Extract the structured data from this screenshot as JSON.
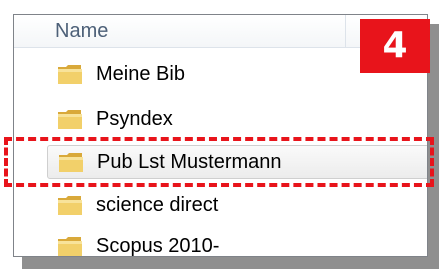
{
  "column_header": {
    "label": "Name"
  },
  "step_badge": {
    "number": "4",
    "color": "#e8141b"
  },
  "folders": [
    {
      "label": "Meine Bib",
      "icon": "folder-icon"
    },
    {
      "label": "Psyndex",
      "icon": "folder-icon"
    },
    {
      "label": "Pub Lst Mustermann",
      "icon": "folder-icon",
      "highlighted": true
    },
    {
      "label": "science direct",
      "icon": "folder-icon"
    },
    {
      "label": "Scopus 2010-",
      "icon": "folder-icon"
    }
  ],
  "highlight": {
    "style": "dashed",
    "color": "#e8141b"
  }
}
